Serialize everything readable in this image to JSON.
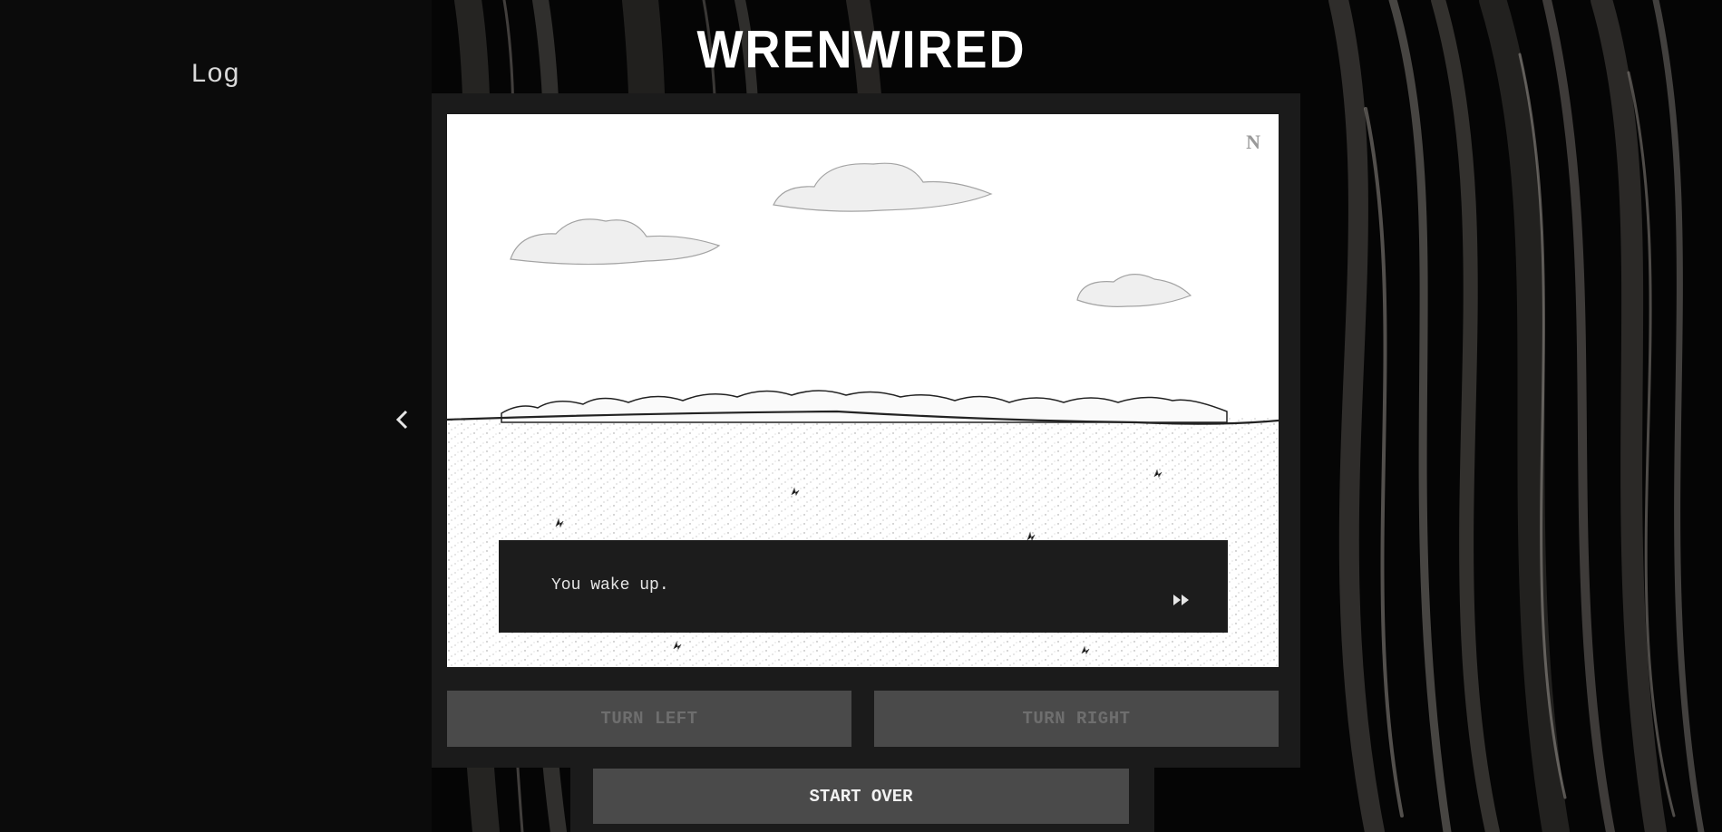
{
  "app": {
    "title": "WRENWIRED"
  },
  "sidebar": {
    "title": "Log",
    "collapse_icon": "chevron-left-icon"
  },
  "scene": {
    "compass_direction": "N",
    "dialog_text": "You wake up.",
    "advance_icon": "fast-forward-icon"
  },
  "controls": {
    "turn_left_label": "TURN LEFT",
    "turn_right_label": "TURN RIGHT",
    "start_over_label": "START OVER"
  },
  "colors": {
    "background": "#000000",
    "sidebar": "#0b0b0b",
    "frame": "#1b1b1b",
    "button": "#4a4a4a",
    "dialog": "#1c1c1c"
  }
}
